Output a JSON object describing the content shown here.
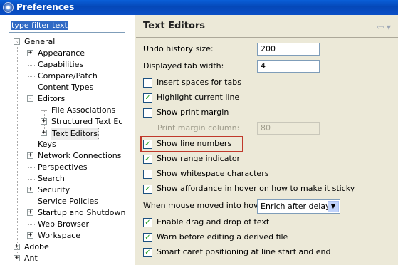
{
  "window": {
    "title": "Preferences"
  },
  "filter": {
    "text": "type filter text"
  },
  "tree": {
    "items": [
      {
        "label": "General",
        "expander": "-"
      },
      {
        "label": "Appearance",
        "expander": "+"
      },
      {
        "label": "Capabilities",
        "expander": ""
      },
      {
        "label": "Compare/Patch",
        "expander": ""
      },
      {
        "label": "Content Types",
        "expander": ""
      },
      {
        "label": "Editors",
        "expander": "-"
      },
      {
        "label": "File Associations",
        "expander": ""
      },
      {
        "label": "Structured Text Ec",
        "expander": "+"
      },
      {
        "label": "Text Editors",
        "expander": "+",
        "selected": true
      },
      {
        "label": "Keys",
        "expander": ""
      },
      {
        "label": "Network Connections",
        "expander": "+"
      },
      {
        "label": "Perspectives",
        "expander": ""
      },
      {
        "label": "Search",
        "expander": ""
      },
      {
        "label": "Security",
        "expander": "+"
      },
      {
        "label": "Service Policies",
        "expander": ""
      },
      {
        "label": "Startup and Shutdown",
        "expander": "+"
      },
      {
        "label": "Web Browser",
        "expander": ""
      },
      {
        "label": "Workspace",
        "expander": "+"
      },
      {
        "label": "Adobe",
        "expander": "+"
      },
      {
        "label": "Ant",
        "expander": "+"
      }
    ]
  },
  "page": {
    "title": "Text Editors",
    "nav_arrows": "⇦ ▾",
    "undo_label": "Undo history size:",
    "undo_value": "200",
    "tab_label": "Displayed tab width:",
    "tab_value": "4",
    "options": [
      {
        "label": "Insert spaces for tabs",
        "checked": false
      },
      {
        "label": "Highlight current line",
        "checked": true
      },
      {
        "label": "Show print margin",
        "checked": false
      }
    ],
    "print_margin_label": "Print margin column:",
    "print_margin_value": "80",
    "options2": [
      {
        "label": "Show line numbers",
        "checked": true
      },
      {
        "label": "Show range indicator",
        "checked": true
      },
      {
        "label": "Show whitespace characters",
        "checked": false
      },
      {
        "label": "Show affordance in hover on how to make it sticky",
        "checked": true
      }
    ],
    "hover_label": "When mouse moved into hover:",
    "hover_value": "Enrich after delay",
    "options3": [
      {
        "label": "Enable drag and drop of text",
        "checked": true
      },
      {
        "label": "Warn before editing a derived file",
        "checked": true
      },
      {
        "label": "Smart caret positioning at line start and end",
        "checked": true
      }
    ]
  },
  "colors": {
    "titlebar": "#0548b8",
    "highlight_box": "#c0392b",
    "selection": "#316ac5"
  }
}
